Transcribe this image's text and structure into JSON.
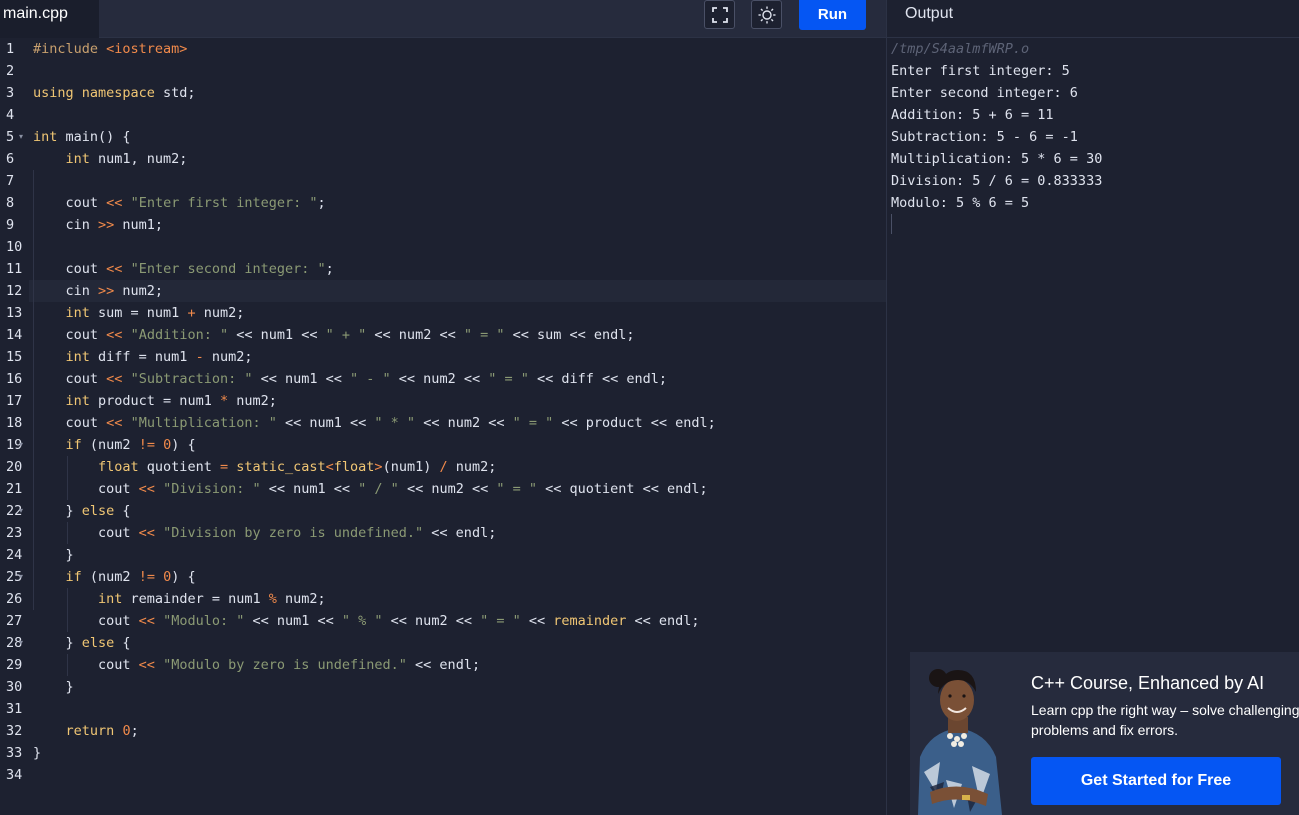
{
  "file_tab": "main.cpp",
  "toolbar": {
    "run_label": "Run"
  },
  "output_title": "Output",
  "output": {
    "path": "/tmp/S4aalmfWRP.o",
    "lines": [
      "Enter first integer: 5",
      "Enter second integer: 6",
      "Addition: 5 + 6 = 11",
      "Subtraction: 5 - 6 = -1",
      "Multiplication: 5 * 6 = 30",
      "Division: 5 / 6 = 0.833333",
      "Modulo: 5 % 6 = 5"
    ]
  },
  "editor": {
    "line_numbers": [
      "1",
      "2",
      "3",
      "4",
      "5",
      "6",
      "7",
      "8",
      "9",
      "10",
      "11",
      "12",
      "13",
      "14",
      "15",
      "16",
      "17",
      "18",
      "19",
      "20",
      "21",
      "22",
      "23",
      "24",
      "25",
      "26",
      "27",
      "28",
      "29",
      "30",
      "31",
      "32",
      "33",
      "34"
    ],
    "code_lines": [
      [
        [
          "pp",
          "#include "
        ],
        [
          "inc",
          "<iostream>"
        ]
      ],
      [],
      [
        [
          "kw",
          "using namespace"
        ],
        [
          "tx",
          " std;"
        ]
      ],
      [],
      [
        [
          "ty",
          "int"
        ],
        [
          "tx",
          " main() {"
        ]
      ],
      [
        [
          "tx",
          "    "
        ],
        [
          "ty",
          "int"
        ],
        [
          "tx",
          " num1, num2;"
        ]
      ],
      [],
      [
        [
          "tx",
          "    cout "
        ],
        [
          "op",
          "<<"
        ],
        [
          "tx",
          " "
        ],
        [
          "st",
          "\"Enter first integer: \""
        ],
        [
          "tx",
          ";"
        ]
      ],
      [
        [
          "tx",
          "    cin "
        ],
        [
          "op",
          ">>"
        ],
        [
          "tx",
          " num1;"
        ]
      ],
      [],
      [
        [
          "tx",
          "    cout "
        ],
        [
          "op",
          "<<"
        ],
        [
          "tx",
          " "
        ],
        [
          "st",
          "\"Enter second integer: \""
        ],
        [
          "tx",
          ";"
        ]
      ],
      [
        [
          "tx",
          "    cin "
        ],
        [
          "op",
          ">>"
        ],
        [
          "tx",
          " num2;"
        ]
      ],
      [
        [
          "tx",
          "    "
        ],
        [
          "ty",
          "int"
        ],
        [
          "tx",
          " sum = num1 "
        ],
        [
          "op",
          "+"
        ],
        [
          "tx",
          " num2;"
        ]
      ],
      [
        [
          "tx",
          "    cout "
        ],
        [
          "op",
          "<<"
        ],
        [
          "tx",
          " "
        ],
        [
          "st",
          "\"Addition: \""
        ],
        [
          "tx",
          " << num1 << "
        ],
        [
          "st",
          "\" + \""
        ],
        [
          "tx",
          " << num2 << "
        ],
        [
          "st",
          "\" = \""
        ],
        [
          "tx",
          " << sum << endl;"
        ]
      ],
      [
        [
          "tx",
          "    "
        ],
        [
          "ty",
          "int"
        ],
        [
          "tx",
          " diff = num1 "
        ],
        [
          "op",
          "-"
        ],
        [
          "tx",
          " num2;"
        ]
      ],
      [
        [
          "tx",
          "    cout "
        ],
        [
          "op",
          "<<"
        ],
        [
          "tx",
          " "
        ],
        [
          "st",
          "\"Subtraction: \""
        ],
        [
          "tx",
          " << num1 << "
        ],
        [
          "st",
          "\" - \""
        ],
        [
          "tx",
          " << num2 << "
        ],
        [
          "st",
          "\" = \""
        ],
        [
          "tx",
          " << diff << endl;"
        ]
      ],
      [
        [
          "tx",
          "    "
        ],
        [
          "ty",
          "int"
        ],
        [
          "tx",
          " product = num1 "
        ],
        [
          "op",
          "*"
        ],
        [
          "tx",
          " num2;"
        ]
      ],
      [
        [
          "tx",
          "    cout "
        ],
        [
          "op",
          "<<"
        ],
        [
          "tx",
          " "
        ],
        [
          "st",
          "\"Multiplication: \""
        ],
        [
          "tx",
          " << num1 << "
        ],
        [
          "st",
          "\" * \""
        ],
        [
          "tx",
          " << num2 << "
        ],
        [
          "st",
          "\" = \""
        ],
        [
          "tx",
          " << product << endl;"
        ]
      ],
      [
        [
          "tx",
          "    "
        ],
        [
          "kw",
          "if"
        ],
        [
          "tx",
          " (num2 "
        ],
        [
          "op",
          "!="
        ],
        [
          "tx",
          " "
        ],
        [
          "nm",
          "0"
        ],
        [
          "tx",
          ") {"
        ]
      ],
      [
        [
          "tx",
          "        "
        ],
        [
          "ty",
          "float"
        ],
        [
          "tx",
          " quotient "
        ],
        [
          "op",
          "="
        ],
        [
          "tx",
          " "
        ],
        [
          "kw",
          "static_cast"
        ],
        [
          "op",
          "<"
        ],
        [
          "ty",
          "float"
        ],
        [
          "op",
          ">"
        ],
        [
          "tx",
          "(num1) "
        ],
        [
          "op",
          "/"
        ],
        [
          "tx",
          " num2;"
        ]
      ],
      [
        [
          "tx",
          "        cout "
        ],
        [
          "op",
          "<<"
        ],
        [
          "tx",
          " "
        ],
        [
          "st",
          "\"Division: \""
        ],
        [
          "tx",
          " << num1 << "
        ],
        [
          "st",
          "\" / \""
        ],
        [
          "tx",
          " << num2 << "
        ],
        [
          "st",
          "\" = \""
        ],
        [
          "tx",
          " << quotient << endl;"
        ]
      ],
      [
        [
          "tx",
          "    } "
        ],
        [
          "kw",
          "else"
        ],
        [
          "tx",
          " {"
        ]
      ],
      [
        [
          "tx",
          "        cout "
        ],
        [
          "op",
          "<<"
        ],
        [
          "tx",
          " "
        ],
        [
          "st",
          "\"Division by zero is undefined.\""
        ],
        [
          "tx",
          " << endl;"
        ]
      ],
      [
        [
          "tx",
          "    }"
        ]
      ],
      [
        [
          "tx",
          "    "
        ],
        [
          "kw",
          "if"
        ],
        [
          "tx",
          " (num2 "
        ],
        [
          "op",
          "!="
        ],
        [
          "tx",
          " "
        ],
        [
          "nm",
          "0"
        ],
        [
          "tx",
          ") {"
        ]
      ],
      [
        [
          "tx",
          "        "
        ],
        [
          "ty",
          "int"
        ],
        [
          "tx",
          " remainder = num1 "
        ],
        [
          "op",
          "%"
        ],
        [
          "tx",
          " num2;"
        ]
      ],
      [
        [
          "tx",
          "        cout "
        ],
        [
          "op",
          "<<"
        ],
        [
          "tx",
          " "
        ],
        [
          "st",
          "\"Modulo: \""
        ],
        [
          "tx",
          " << num1 << "
        ],
        [
          "st",
          "\" % \""
        ],
        [
          "tx",
          " << num2 << "
        ],
        [
          "st",
          "\" = \""
        ],
        [
          "tx",
          " << "
        ],
        [
          "kw",
          "remainder"
        ],
        [
          "tx",
          " << endl;"
        ]
      ],
      [
        [
          "tx",
          "    } "
        ],
        [
          "kw",
          "else"
        ],
        [
          "tx",
          " {"
        ]
      ],
      [
        [
          "tx",
          "        cout "
        ],
        [
          "op",
          "<<"
        ],
        [
          "tx",
          " "
        ],
        [
          "st",
          "\"Modulo by zero is undefined.\""
        ],
        [
          "tx",
          " << endl;"
        ]
      ],
      [
        [
          "tx",
          "    }"
        ]
      ],
      [],
      [
        [
          "tx",
          "    "
        ],
        [
          "kw",
          "return"
        ],
        [
          "tx",
          " "
        ],
        [
          "nm",
          "0"
        ],
        [
          "tx",
          ";"
        ]
      ],
      [
        [
          "tx",
          "}"
        ]
      ],
      []
    ],
    "fold_markers": [
      "5",
      "19",
      "22",
      "25",
      "28"
    ]
  },
  "ad": {
    "title": "C++ Course, Enhanced by AI",
    "description": "Learn cpp the right way – solve challenging problems and fix errors.",
    "cta_label": "Get Started for Free"
  },
  "colors": {
    "background": "#1d2130",
    "run_button": "#0556f3",
    "keyword": "#f0c674",
    "operator": "#f18a4b",
    "string": "#8b9a74"
  },
  "icons": {
    "fullscreen": "fullscreen-icon",
    "theme": "sun-icon",
    "fold": "chevron-down-icon"
  }
}
